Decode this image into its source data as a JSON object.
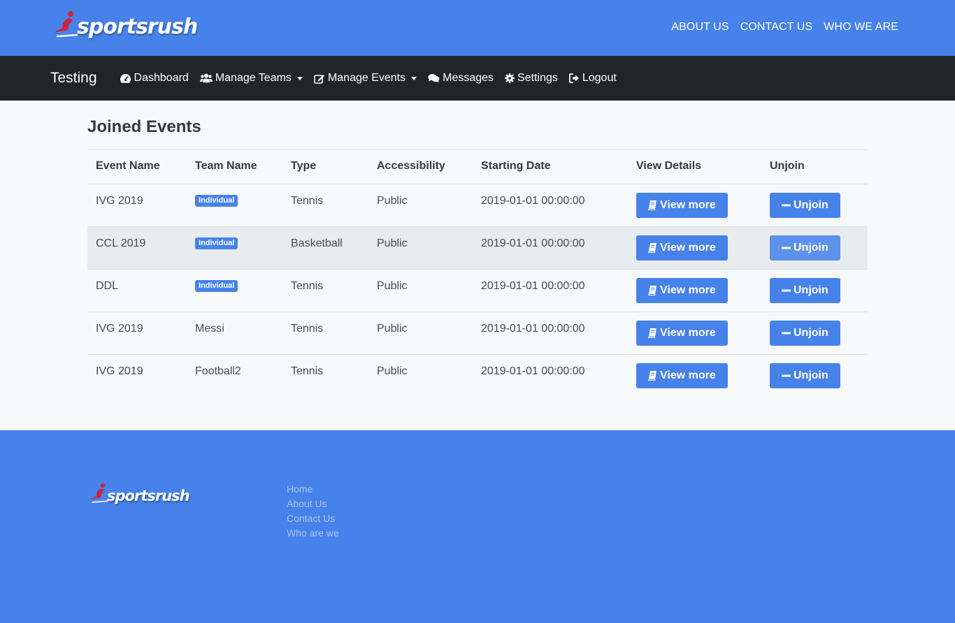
{
  "brand": {
    "logo_text": "sportsrush",
    "accent": "#d0213b"
  },
  "top_links": [
    "ABOUT US",
    "CONTACT US",
    "WHO WE ARE"
  ],
  "navbar": {
    "brand": "Testing",
    "items": [
      {
        "label": "Dashboard",
        "icon": "dashboard-icon"
      },
      {
        "label": "Manage Teams",
        "icon": "users-icon",
        "dropdown": true
      },
      {
        "label": "Manage Events",
        "icon": "edit-icon",
        "dropdown": true
      },
      {
        "label": "Messages",
        "icon": "comments-icon"
      },
      {
        "label": "Settings",
        "icon": "gear-icon"
      },
      {
        "label": "Logout",
        "icon": "logout-icon"
      }
    ]
  },
  "page": {
    "title": "Joined Events"
  },
  "table": {
    "headers": [
      "Event Name",
      "Team Name",
      "Type",
      "Accessibility",
      "Starting Date",
      "View Details",
      "Unjoin"
    ],
    "rows": [
      {
        "event": "IVG 2019",
        "team": "Individual",
        "team_is_badge": true,
        "type": "Tennis",
        "access": "Public",
        "date": "2019-01-01 00:00:00"
      },
      {
        "event": "CCL 2019",
        "team": "Individual",
        "team_is_badge": true,
        "type": "Basketball",
        "access": "Public",
        "date": "2019-01-01 00:00:00"
      },
      {
        "event": "DDL",
        "team": "Individual",
        "team_is_badge": true,
        "type": "Tennis",
        "access": "Public",
        "date": "2019-01-01 00:00:00"
      },
      {
        "event": "IVG 2019",
        "team": "Messi",
        "team_is_badge": false,
        "type": "Tennis",
        "access": "Public",
        "date": "2019-01-01 00:00:00"
      },
      {
        "event": "IVG 2019",
        "team": "Football2",
        "team_is_badge": false,
        "type": "Tennis",
        "access": "Public",
        "date": "2019-01-01 00:00:00"
      }
    ],
    "view_label": "View more",
    "unjoin_label": "Unjoin"
  },
  "footer": {
    "logo_text": "sportsrush",
    "links": [
      "Home",
      "About Us",
      "Contact Us",
      "Who are we"
    ]
  },
  "colors": {
    "primary": "#4682e9",
    "navbar": "#212529",
    "footer_link": "#a9c4f3"
  }
}
